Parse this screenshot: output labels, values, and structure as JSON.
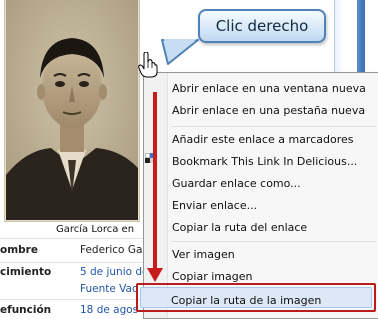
{
  "callout": {
    "text": "Clic derecho"
  },
  "photo": {
    "caption": "García Lorca en"
  },
  "infobox": {
    "rows": [
      {
        "label": "ombre",
        "value": "Federico Ga"
      },
      {
        "label": "cimiento",
        "value": "5 de junio de",
        "value2": "Fuente Vac"
      },
      {
        "label": "efunción",
        "value": "18 de agos"
      }
    ]
  },
  "context_menu": {
    "items": [
      {
        "label": "Abrir enlace en una ventana nueva"
      },
      {
        "label": "Abrir enlace en una pestaña nueva"
      },
      {
        "label": "Añadir este enlace a marcadores"
      },
      {
        "label": "Bookmark This Link In Delicious..."
      },
      {
        "label": "Guardar enlace como..."
      },
      {
        "label": "Enviar enlace..."
      },
      {
        "label": "Copiar la ruta del enlace"
      },
      {
        "label": "Ver imagen"
      },
      {
        "label": "Copiar imagen"
      },
      {
        "label": "Copiar la ruta de la imagen"
      }
    ],
    "highlighted_index": 9
  },
  "colors": {
    "annotation_red": "#c81b1b",
    "callout_border": "#4f82b7",
    "link_blue": "#2255aa",
    "menu_highlight": "#dce8f6"
  }
}
